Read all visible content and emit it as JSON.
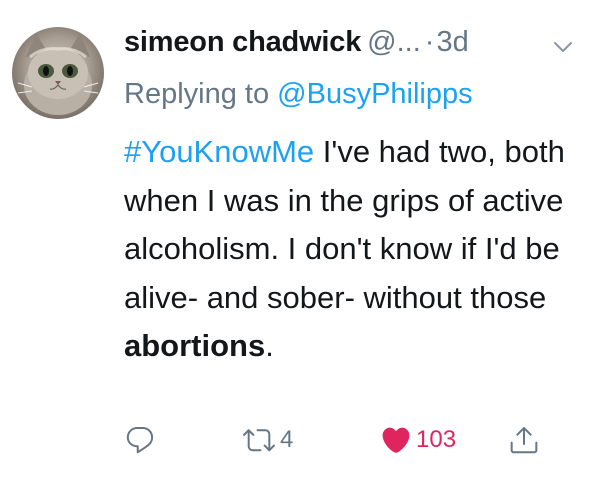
{
  "tweet": {
    "author_name": "simeon chadwick",
    "author_handle": "@...",
    "separator": "·",
    "timestamp": "3d",
    "reply_prefix": "Replying to ",
    "reply_to": "@BusyPhilipps",
    "hashtag": "#YouKnowMe",
    "text_main": " I've had two, both when I was in the grips of active alcoholism. I don't know if I'd be alive- and sober- without those ",
    "text_bold": "abortions",
    "text_end": ".",
    "retweet_count": "4",
    "like_count": "103"
  },
  "colors": {
    "link": "#1da1f2",
    "muted": "#657786",
    "like": "#e0245e"
  },
  "icons": {
    "avatar": "kitten-avatar",
    "menu": "chevron-down-icon",
    "reply": "reply-icon",
    "retweet": "retweet-icon",
    "like": "heart-icon",
    "share": "share-icon"
  }
}
